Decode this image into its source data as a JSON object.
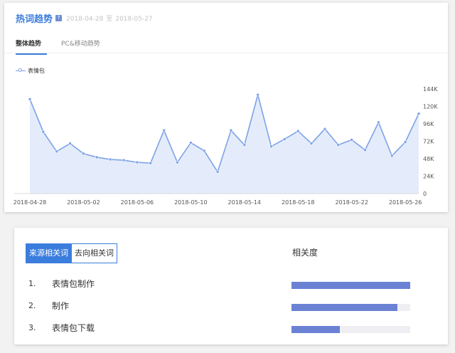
{
  "trend": {
    "title": "热词趋势",
    "help_icon": "question-icon",
    "date_start": "2018-04-28",
    "date_sep": "至",
    "date_end": "2018-05-27",
    "tabs": [
      {
        "label": "整体趋势",
        "active": true
      },
      {
        "label": "PC&移动趋势",
        "active": false
      }
    ],
    "accent_color": "#3b7ddd",
    "line_color": "#7ea2e6",
    "fill_color": "#e4ecfb"
  },
  "chart_data": {
    "type": "area",
    "title": "",
    "xlabel": "",
    "ylabel": "",
    "series": [
      {
        "name": "表情包",
        "values": [
          130000,
          85000,
          58000,
          69000,
          55000,
          50000,
          47000,
          46000,
          43000,
          42000,
          87000,
          43000,
          70000,
          59000,
          30000,
          87000,
          67000,
          136000,
          65000,
          75000,
          86000,
          69000,
          89000,
          67000,
          74000,
          60000,
          98000,
          52000,
          71000,
          110000
        ]
      }
    ],
    "x": [
      "2018-04-28",
      "2018-04-29",
      "2018-04-30",
      "2018-05-01",
      "2018-05-02",
      "2018-05-03",
      "2018-05-04",
      "2018-05-05",
      "2018-05-06",
      "2018-05-07",
      "2018-05-08",
      "2018-05-09",
      "2018-05-10",
      "2018-05-11",
      "2018-05-12",
      "2018-05-13",
      "2018-05-14",
      "2018-05-15",
      "2018-05-16",
      "2018-05-17",
      "2018-05-18",
      "2018-05-19",
      "2018-05-20",
      "2018-05-21",
      "2018-05-22",
      "2018-05-23",
      "2018-05-24",
      "2018-05-25",
      "2018-05-26",
      "2018-05-27"
    ],
    "x_tick_labels": [
      "2018-04-28",
      "2018-05-02",
      "2018-05-06",
      "2018-05-10",
      "2018-05-14",
      "2018-05-18",
      "2018-05-22",
      "2018-05-26"
    ],
    "y_tick_labels": [
      "144K",
      "120K",
      "96K",
      "72K",
      "48K",
      "24K",
      "0"
    ],
    "y_ticks": [
      144000,
      120000,
      96000,
      72000,
      48000,
      24000,
      0
    ],
    "ylim": [
      0,
      144000
    ],
    "legend_position": "top-left",
    "grid": false
  },
  "related": {
    "buttons": [
      {
        "label": "来源相关词",
        "active": true
      },
      {
        "label": "去向相关词",
        "active": false
      }
    ],
    "relevance_header": "相关度",
    "items": [
      {
        "num": "1.",
        "term": "表情包制作",
        "relevance": 1.0
      },
      {
        "num": "2.",
        "term": "制作",
        "relevance": 0.89
      },
      {
        "num": "3.",
        "term": "表情包下载",
        "relevance": 0.41
      }
    ]
  }
}
